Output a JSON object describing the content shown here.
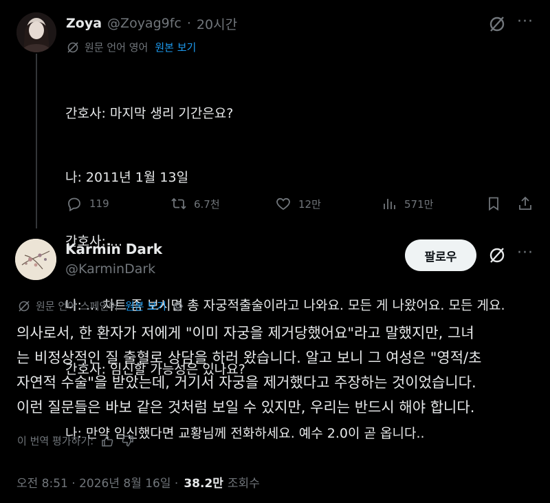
{
  "tweet1": {
    "name": "Zoya",
    "handle": "@Zoyag9fc",
    "separator": "·",
    "time": "20시간",
    "translated_note": "원문 언어 영어",
    "show_original": "원본 보기",
    "lines": [
      "간호사: 마지막 생리 기간은요?",
      "나: 2011년 1월 13일",
      "간호사: ...",
      "나: ... 차트 좀 보시면 총 자궁적출술이라고 나와요. 모든 게 나왔어요. 모든 게요.",
      "간호사: 임신할 가능성은 있나요?",
      "나: 만약 임신했다면 교황님께 전화하세요. 예수 2.0이 곧 옵니다.."
    ],
    "actions": {
      "replies": "119",
      "reposts": "6.7천",
      "likes": "12만",
      "views": "571만"
    }
  },
  "tweet2": {
    "name": "Karmin Dark",
    "handle": "@KarminDark",
    "follow_label": "팔로우",
    "translated_note": "원문 언어 스페인어",
    "show_original": "원본 보기",
    "lines": [
      "의사로서, 한 환자가 저에게 \"이미 자궁을 제거당했어요\"라고 말했지만, 그녀",
      "는 비정상적인 질 출혈로 상담을 하러 왔습니다. 알고 보니 그 여성은 \"영적/초",
      "자연적 수술\"을 받았는데, 거기서 자궁을 제거했다고 주장하는 것이었습니다.",
      "이런 질문들은 바보 같은 것처럼 보일 수 있지만, 우리는 반드시 해야 합니다."
    ],
    "rate_label": "이 번역 평가하기:",
    "timestamp": "오전 8:51 · 2026년 8월 16일 ·",
    "views_count": "38.2만",
    "views_label": "조회수"
  },
  "colors": {
    "background": "#000000",
    "text": "#e7e9ea",
    "muted": "#71767b",
    "link": "#1d9bf0",
    "follow_bg": "#eff3f4"
  }
}
